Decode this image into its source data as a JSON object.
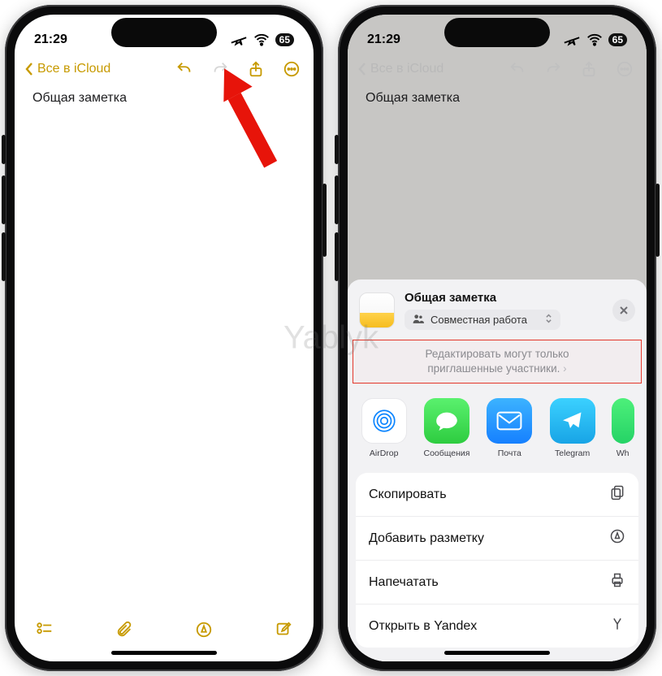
{
  "watermark": "Yablyk",
  "status": {
    "time": "21:29",
    "battery": "65"
  },
  "nav": {
    "back_label": "Все в iCloud"
  },
  "note": {
    "title": "Общая заметка"
  },
  "share": {
    "doc_title": "Общая заметка",
    "collab_label": "Совместная работа",
    "perm_line1": "Редактировать могут только",
    "perm_line2": "приглашенные участники.",
    "apps": {
      "airdrop": "AirDrop",
      "messages": "Сообщения",
      "mail": "Почта",
      "telegram": "Telegram",
      "wh": "Wh"
    },
    "actions": {
      "copy": "Скопировать",
      "markup": "Добавить разметку",
      "print": "Напечатать",
      "yandex": "Открыть в Yandex"
    }
  }
}
